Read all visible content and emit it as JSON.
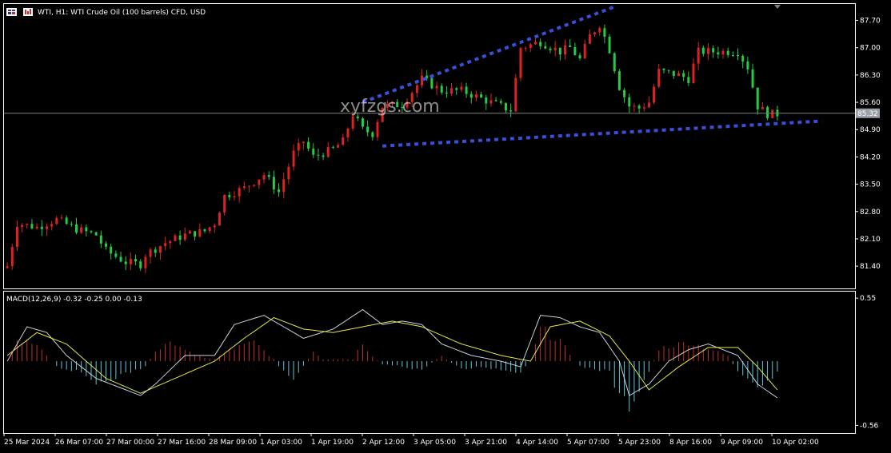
{
  "header": {
    "title": "WTI, H1:  WTI Crude Oil (100 barrels) CFD, USD",
    "icon": "chart-window-icon"
  },
  "watermark": "xyfzgs.com",
  "colors": {
    "bull": "#dd2222",
    "bear": "#22cc44",
    "macd_line": "#c8d0dc",
    "signal_line": "#e6e64a",
    "hist_pos": "#c0302b",
    "hist_neg": "#5fc8d8",
    "trendline": "#3a4fd8",
    "price_line": "#808080",
    "axis": "#ffffff",
    "price_tag": "#9aa0a8"
  },
  "chart_data": [
    {
      "type": "candlestick",
      "title": "WTI, H1:  WTI Crude Oil (100 barrels) CFD, USD",
      "ylim": [
        80.85,
        88.1
      ],
      "y_ticks": [
        "87.70",
        "87.00",
        "86.30",
        "85.60",
        "84.90",
        "84.20",
        "83.50",
        "82.80",
        "82.10",
        "81.40"
      ],
      "current_price": "85.32",
      "x_ticks": [
        "25 Mar 2024",
        "26 Mar 07:00",
        "27 Mar 00:00",
        "27 Mar 16:00",
        "28 Mar 09:00",
        "1 Apr 03:00",
        "1 Apr 19:00",
        "2 Apr 12:00",
        "3 Apr 05:00",
        "3 Apr 21:00",
        "4 Apr 14:00",
        "5 Apr 07:00",
        "5 Apr 23:00",
        "8 Apr 16:00",
        "9 Apr 09:00",
        "10 Apr 02:00"
      ],
      "close_path": [
        [
          0,
          81.4
        ],
        [
          2,
          82.5
        ],
        [
          6,
          82.4
        ],
        [
          10,
          82.6
        ],
        [
          14,
          82.35
        ],
        [
          18,
          82.2
        ],
        [
          20,
          81.8
        ],
        [
          24,
          81.5
        ],
        [
          27,
          81.45
        ],
        [
          28,
          81.7
        ],
        [
          32,
          82.0
        ],
        [
          36,
          82.2
        ],
        [
          40,
          82.3
        ],
        [
          42,
          82.5
        ],
        [
          44,
          83.2
        ],
        [
          48,
          83.4
        ],
        [
          52,
          83.75
        ],
        [
          55,
          83.3
        ],
        [
          58,
          84.3
        ],
        [
          60,
          84.6
        ],
        [
          62,
          84.2
        ],
        [
          66,
          84.4
        ],
        [
          68,
          84.6
        ],
        [
          70,
          85.3
        ],
        [
          72,
          84.9
        ],
        [
          74,
          84.8
        ],
        [
          76,
          85.5
        ],
        [
          80,
          85.55
        ],
        [
          84,
          86.2
        ],
        [
          88,
          85.9
        ],
        [
          92,
          85.9
        ],
        [
          96,
          85.7
        ],
        [
          100,
          85.5
        ],
        [
          102,
          85.4
        ],
        [
          104,
          87.0
        ],
        [
          108,
          87.15
        ],
        [
          112,
          86.9
        ],
        [
          114,
          87.0
        ],
        [
          116,
          86.7
        ],
        [
          118,
          87.3
        ],
        [
          120,
          87.6
        ],
        [
          122,
          86.95
        ],
        [
          124,
          86.0
        ],
        [
          126,
          85.5
        ],
        [
          128,
          85.45
        ],
        [
          130,
          85.6
        ],
        [
          132,
          86.4
        ],
        [
          136,
          86.3
        ],
        [
          138,
          86.2
        ],
        [
          140,
          86.9
        ],
        [
          144,
          86.9
        ],
        [
          148,
          86.9
        ],
        [
          150,
          86.5
        ],
        [
          152,
          85.5
        ],
        [
          154,
          85.3
        ],
        [
          156,
          85.3
        ]
      ],
      "trendlines": [
        {
          "start": {
            "x": 72,
            "y": 85.6
          },
          "end": {
            "x": 123,
            "y": 88.05
          }
        },
        {
          "start": {
            "x": 76,
            "y": 84.48
          },
          "end": {
            "x": 165,
            "y": 85.12
          }
        }
      ]
    },
    {
      "type": "bar",
      "title": "MACD(12,26,9) -0.32 -0.25 0.00 -0.13",
      "ylim": [
        -0.62,
        0.6
      ],
      "y_ticks": [
        "0.55",
        "-0.56"
      ],
      "macd_path": [
        [
          0,
          0.0
        ],
        [
          4,
          0.3
        ],
        [
          8,
          0.25
        ],
        [
          12,
          0.05
        ],
        [
          18,
          -0.15
        ],
        [
          24,
          -0.25
        ],
        [
          27,
          -0.3
        ],
        [
          30,
          -0.2
        ],
        [
          36,
          0.05
        ],
        [
          42,
          0.05
        ],
        [
          46,
          0.32
        ],
        [
          52,
          0.4
        ],
        [
          56,
          0.3
        ],
        [
          60,
          0.2
        ],
        [
          66,
          0.28
        ],
        [
          72,
          0.45
        ],
        [
          76,
          0.32
        ],
        [
          80,
          0.35
        ],
        [
          84,
          0.32
        ],
        [
          88,
          0.15
        ],
        [
          94,
          0.05
        ],
        [
          100,
          0.0
        ],
        [
          104,
          -0.05
        ],
        [
          108,
          0.4
        ],
        [
          112,
          0.38
        ],
        [
          116,
          0.3
        ],
        [
          120,
          0.25
        ],
        [
          124,
          0.0
        ],
        [
          126,
          -0.3
        ],
        [
          130,
          -0.2
        ],
        [
          134,
          0.0
        ],
        [
          138,
          0.1
        ],
        [
          142,
          0.15
        ],
        [
          148,
          0.05
        ],
        [
          152,
          -0.2
        ],
        [
          156,
          -0.32
        ]
      ],
      "signal_path": [
        [
          0,
          0.05
        ],
        [
          6,
          0.25
        ],
        [
          12,
          0.15
        ],
        [
          20,
          -0.15
        ],
        [
          27,
          -0.28
        ],
        [
          34,
          -0.15
        ],
        [
          42,
          0.0
        ],
        [
          48,
          0.2
        ],
        [
          54,
          0.38
        ],
        [
          60,
          0.28
        ],
        [
          66,
          0.25
        ],
        [
          72,
          0.3
        ],
        [
          78,
          0.35
        ],
        [
          84,
          0.3
        ],
        [
          92,
          0.15
        ],
        [
          100,
          0.05
        ],
        [
          106,
          0.0
        ],
        [
          110,
          0.3
        ],
        [
          116,
          0.35
        ],
        [
          122,
          0.22
        ],
        [
          126,
          0.0
        ],
        [
          130,
          -0.25
        ],
        [
          136,
          -0.05
        ],
        [
          142,
          0.12
        ],
        [
          148,
          0.12
        ],
        [
          152,
          -0.05
        ],
        [
          156,
          -0.25
        ]
      ],
      "hist_path": [
        [
          0,
          0.0
        ],
        [
          2,
          0.2
        ],
        [
          5,
          0.2
        ],
        [
          8,
          0.05
        ],
        [
          10,
          -0.05
        ],
        [
          14,
          -0.1
        ],
        [
          18,
          -0.2
        ],
        [
          24,
          -0.12
        ],
        [
          28,
          -0.05
        ],
        [
          30,
          0.1
        ],
        [
          34,
          0.18
        ],
        [
          38,
          0.05
        ],
        [
          42,
          0.02
        ],
        [
          46,
          0.12
        ],
        [
          50,
          0.18
        ],
        [
          54,
          0.02
        ],
        [
          56,
          -0.1
        ],
        [
          58,
          -0.18
        ],
        [
          60,
          -0.05
        ],
        [
          62,
          0.1
        ],
        [
          64,
          0.02
        ],
        [
          70,
          0.02
        ],
        [
          72,
          0.18
        ],
        [
          74,
          0.05
        ],
        [
          76,
          -0.03
        ],
        [
          80,
          -0.05
        ],
        [
          84,
          -0.08
        ],
        [
          88,
          0.05
        ],
        [
          92,
          -0.08
        ],
        [
          96,
          -0.05
        ],
        [
          100,
          -0.08
        ],
        [
          104,
          -0.1
        ],
        [
          106,
          0.0
        ],
        [
          108,
          0.3
        ],
        [
          112,
          0.2
        ],
        [
          114,
          0.05
        ],
        [
          116,
          -0.05
        ],
        [
          120,
          -0.08
        ],
        [
          122,
          -0.1
        ],
        [
          124,
          -0.35
        ],
        [
          126,
          -0.42
        ],
        [
          130,
          -0.1
        ],
        [
          132,
          0.12
        ],
        [
          138,
          0.18
        ],
        [
          142,
          0.12
        ],
        [
          146,
          0.05
        ],
        [
          148,
          -0.1
        ],
        [
          152,
          -0.28
        ],
        [
          156,
          -0.12
        ]
      ]
    }
  ]
}
